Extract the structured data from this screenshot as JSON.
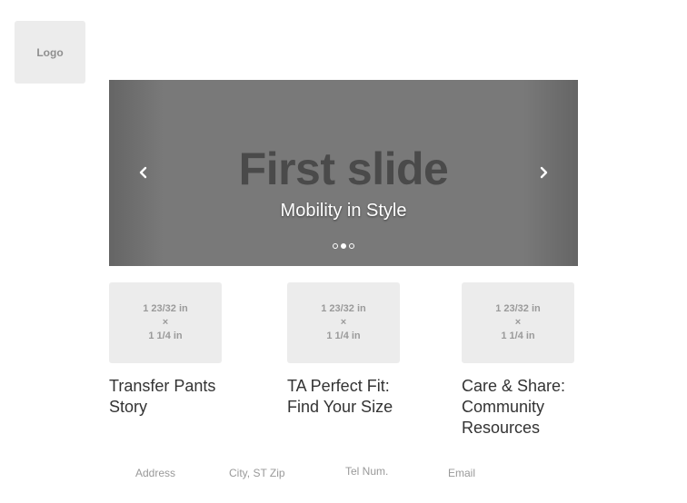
{
  "logo": {
    "label": "Logo"
  },
  "carousel": {
    "title": "First slide",
    "caption": "Mobility in Style",
    "prev_glyph": "‹",
    "next_glyph": "›",
    "indicators": {
      "count": 3,
      "active_index": 1
    }
  },
  "cards": [
    {
      "thumb_line1": "1 23/32 in",
      "thumb_line2": "×",
      "thumb_line3": "1 1/4 in",
      "title": "Transfer Pants Story"
    },
    {
      "thumb_line1": "1 23/32 in",
      "thumb_line2": "×",
      "thumb_line3": "1 1/4 in",
      "title": "TA Perfect Fit: Find Your Size"
    },
    {
      "thumb_line1": "1 23/32 in",
      "thumb_line2": "×",
      "thumb_line3": "1 1/4 in",
      "title": "Care & Share: Community Resources"
    }
  ],
  "footer": {
    "address": "Address",
    "city": "City, ST Zip",
    "tel": "Tel Num.",
    "email": "Email"
  }
}
